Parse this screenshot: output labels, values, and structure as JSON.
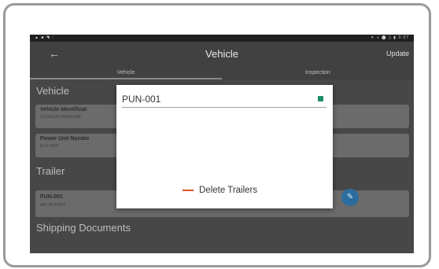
{
  "statusbar": {
    "left_icons": "▲ ■ ◥ ◌",
    "right_text": "✦ ◖ ⬤ ▯ ▮ 3:37"
  },
  "appbar": {
    "back_icon": "←",
    "title": "Vehicle",
    "update_label": "Update"
  },
  "tabs": [
    {
      "label": "Vehicle"
    },
    {
      "label": "Inspection"
    }
  ],
  "content": {
    "vehicle_section": "Vehicle",
    "vehicle_card": {
      "title": "Vehicle Identificat",
      "subtitle": "1GCEK19TX4E301998"
    },
    "power_card": {
      "title": "Power Unit Numbe",
      "subtitle": "ELD-TEST"
    },
    "trailer_section": "Trailer",
    "trailer_card": {
      "title": "PUN-001",
      "subtitle": "AB | BDY0001"
    },
    "shipping_section": "Shipping Documents"
  },
  "fab": {
    "icon": "✎"
  },
  "dialog": {
    "input_value": "PUN-001",
    "delete_label": "Delete Trailers"
  },
  "colors": {
    "accent": "#2b6d9e",
    "delete": "#e2502c",
    "check": "#1d8d66"
  }
}
